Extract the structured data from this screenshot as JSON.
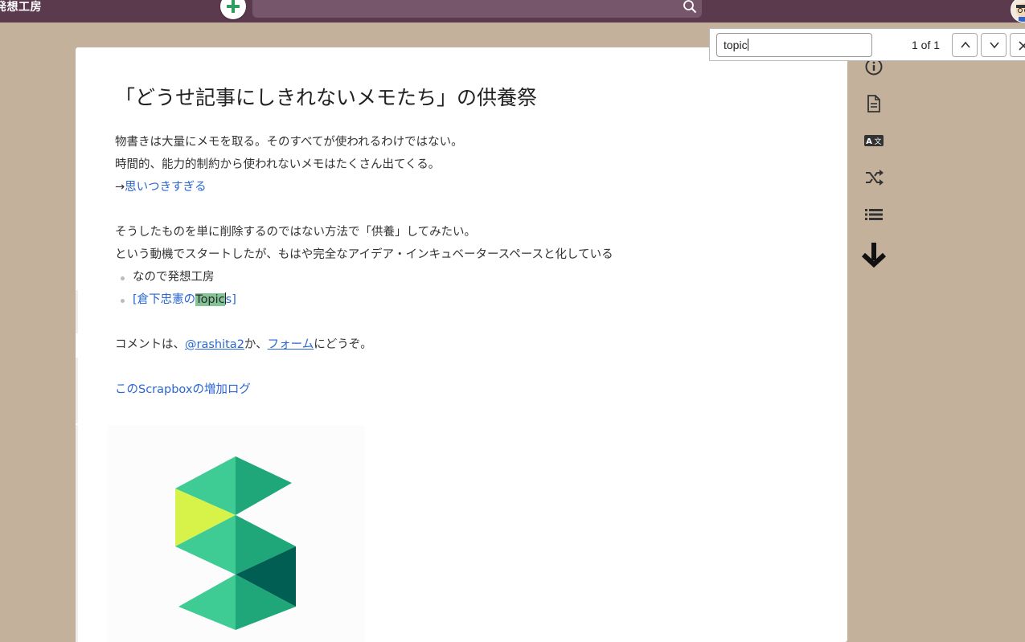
{
  "header": {
    "project_name": "発想工房",
    "search_placeholder": ""
  },
  "find_bar": {
    "query": "topic",
    "match_count": "1 of 1"
  },
  "page": {
    "title": "「どうせ記事にしきれないメモたち」の供養祭",
    "lines": {
      "l1": "物書きは大量にメモを取る。そのすべてが使われるわけではない。",
      "l2": "時間的、能力的制約から使われないメモはたくさん出てくる。",
      "l3_arrow": "→",
      "l3_link": "思いつきすぎる",
      "l4": "そうしたものを単に削除するのではない方法で「供養」してみたい。",
      "l5": "という動機でスタートしたが、もはや完全なアイデア・インキュベータースペースと化している",
      "b1": "なので発想工房",
      "b2_pre": "[倉下忠憲の",
      "b2_hl": "Topic",
      "b2_post": "s]",
      "c_pre": "コメントは、",
      "c_link1": "@rashita2",
      "c_mid": "か、",
      "c_link2": "フォーム",
      "c_post": "にどうぞ。",
      "log_link": "このScrapboxの増加ログ"
    }
  },
  "side_toolbar": {
    "icons": [
      "info-icon",
      "document-icon",
      "translate-icon",
      "shuffle-icon",
      "list-icon",
      "arrow-down-icon"
    ]
  },
  "colors": {
    "header_bg": "#5c3a4e",
    "page_bg": "#c4b19b",
    "link": "#2a67d1",
    "highlight": "#83c497"
  }
}
